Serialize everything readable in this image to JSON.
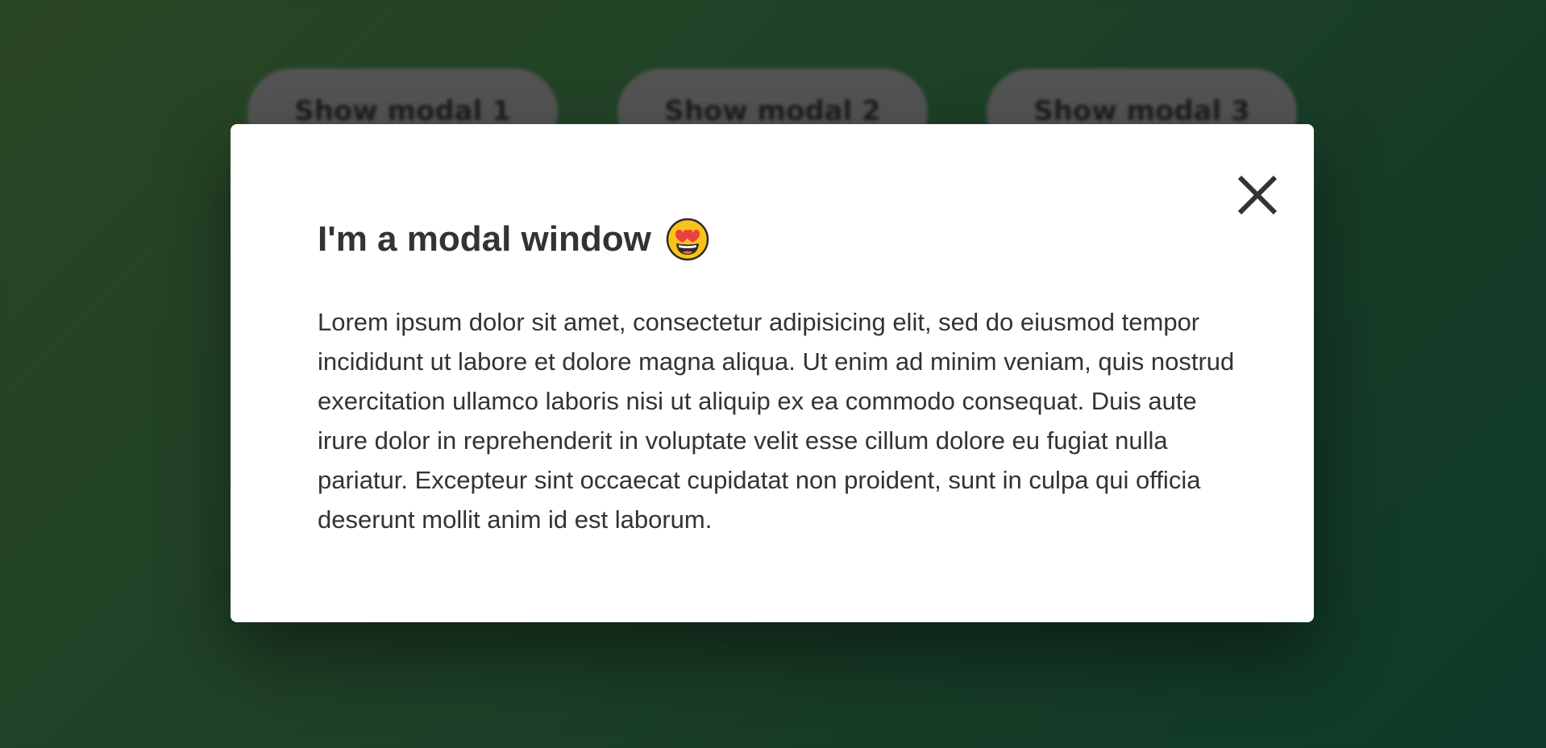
{
  "buttons": [
    {
      "label": "Show modal 1"
    },
    {
      "label": "Show modal 2"
    },
    {
      "label": "Show modal 3"
    }
  ],
  "modal": {
    "title": "I'm a modal window",
    "title_icon": "heart-eyes-emoji-icon",
    "close_icon": "close-icon",
    "body": "Lorem ipsum dolor sit amet, consectetur adipisicing elit, sed do eiusmod tempor incididunt ut labore et dolore magna aliqua. Ut enim ad minim veniam, quis nostrud exercitation ullamco laboris nisi ut aliquip ex ea commodo consequat. Duis aute irure dolor in reprehenderit in voluptate velit esse cillum dolore eu fugiat nulla pariatur. Excepteur sint occaecat cupidatat non proident, sunt in culpa qui officia deserunt mollit anim id est laborum."
  },
  "colors": {
    "background_start": "#365a2f",
    "background_end": "#134a35",
    "button_bg": "#6b6b6b",
    "text": "#333333",
    "emoji_heart": "#e8423f",
    "emoji_face": "#fcc21b"
  }
}
